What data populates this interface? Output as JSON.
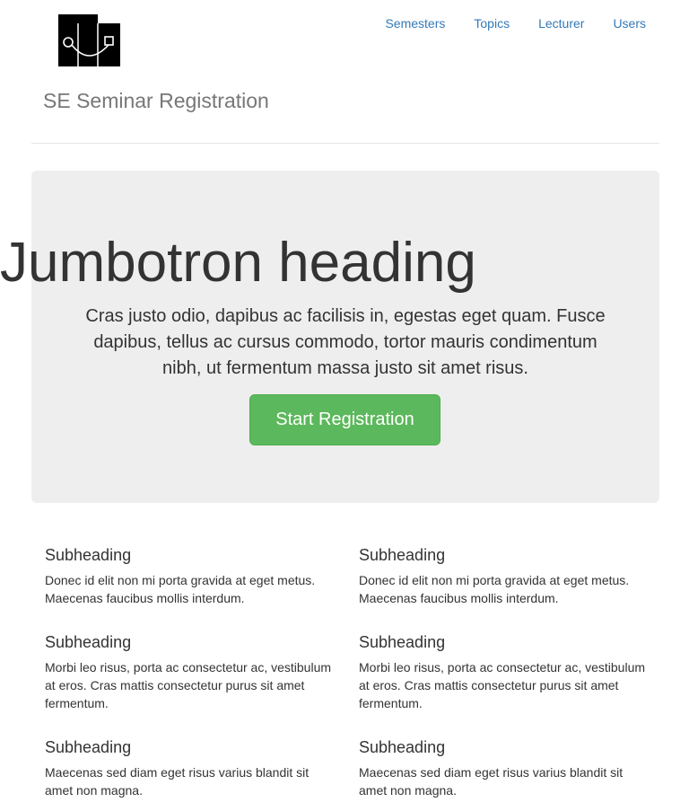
{
  "header": {
    "logo": "se-seminar-logo",
    "title": "SE Seminar Registration",
    "nav": [
      {
        "label": "Semesters"
      },
      {
        "label": "Topics"
      },
      {
        "label": "Lecturer"
      },
      {
        "label": "Users"
      }
    ]
  },
  "jumbotron": {
    "heading": "Jumbotron heading",
    "text": "Cras justo odio, dapibus ac facilisis in, egestas eget quam. Fusce dapibus, tellus ac cursus commodo, tortor mauris condimentum nibh, ut fermentum massa justo sit amet risus.",
    "button_label": "Start Registration",
    "button_color": "#5cb85c",
    "background_color": "#eeeeee"
  },
  "columns": [
    {
      "items": [
        {
          "heading": "Subheading",
          "text": "Donec id elit non mi porta gravida at eget metus. Maecenas faucibus mollis interdum."
        },
        {
          "heading": "Subheading",
          "text": "Morbi leo risus, porta ac consectetur ac, vestibulum at eros. Cras mattis consectetur purus sit amet fermentum."
        },
        {
          "heading": "Subheading",
          "text": "Maecenas sed diam eget risus varius blandit sit amet non magna."
        }
      ]
    },
    {
      "items": [
        {
          "heading": "Subheading",
          "text": "Donec id elit non mi porta gravida at eget metus. Maecenas faucibus mollis interdum."
        },
        {
          "heading": "Subheading",
          "text": "Morbi leo risus, porta ac consectetur ac, vestibulum at eros. Cras mattis consectetur purus sit amet fermentum."
        },
        {
          "heading": "Subheading",
          "text": "Maecenas sed diam eget risus varius blandit sit amet non magna."
        }
      ]
    }
  ],
  "colors": {
    "link": "#337ab7",
    "brand_text": "#777777",
    "body_text": "#333333"
  }
}
